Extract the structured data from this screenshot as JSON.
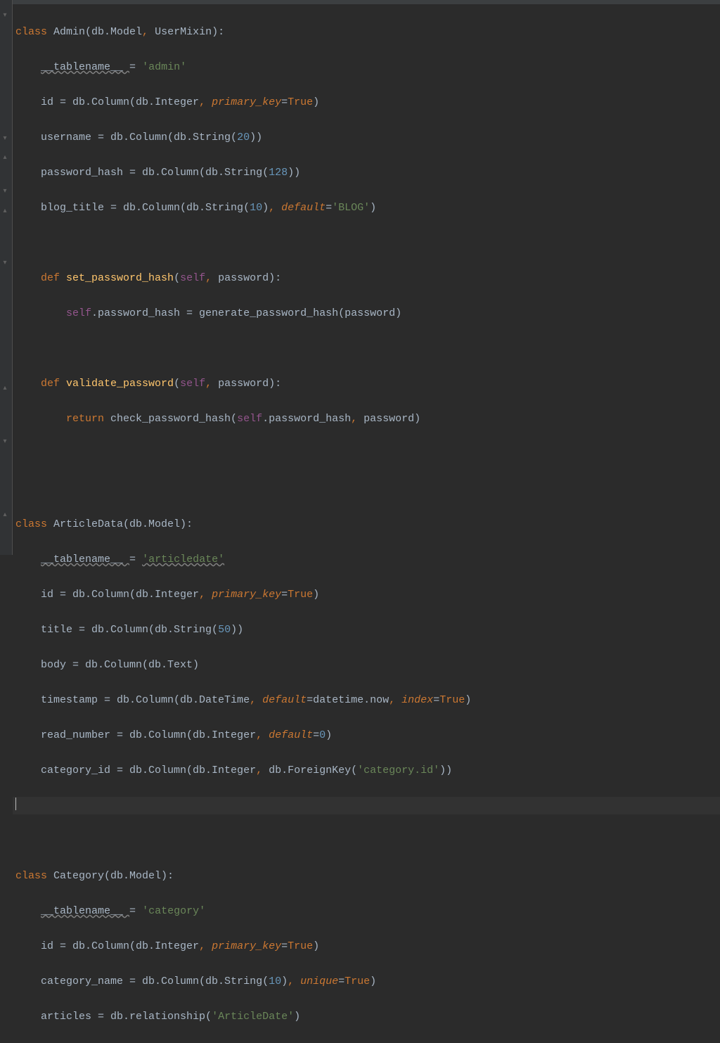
{
  "code": {
    "l1": {
      "kw1": "class ",
      "name": "Admin",
      "rest1": "(db.Model",
      "comma": ", ",
      "rest2": "UserMixin):"
    },
    "l2": {
      "attr": "__tablename__ ",
      "eq": "= ",
      "str": "'admin'"
    },
    "l3": {
      "a": "id = db.Column(db.Integer",
      "c": ", ",
      "p": "primary_key",
      "eq": "=",
      "kw": "True",
      "r": ")"
    },
    "l4": {
      "a": "username = db.Column(db.String(",
      "n": "20",
      "r": "))"
    },
    "l5": {
      "a": "password_hash = db.Column(db.String(",
      "n": "128",
      "r": "))"
    },
    "l6": {
      "a": "blog_title = db.Column(db.String(",
      "n": "10",
      "r1": ")",
      "c": ", ",
      "p": "default",
      "eq": "=",
      "s": "'BLOG'",
      "r2": ")"
    },
    "l8": {
      "kw": "def ",
      "fn": "set_password_hash",
      "op": "(",
      "self": "self",
      "c": ", ",
      "arg": "password):"
    },
    "l9": {
      "self": "self",
      "rest": ".password_hash = generate_password_hash(password)"
    },
    "l11": {
      "kw": "def ",
      "fn": "validate_password",
      "op": "(",
      "self": "self",
      "c": ", ",
      "arg": "password):"
    },
    "l12": {
      "kw": "return ",
      "a": "check_password_hash(",
      "self": "self",
      "rest": ".password_hash",
      "c": ", ",
      "r": "password)"
    },
    "l15": {
      "kw": "class ",
      "name": "ArticleData",
      "rest": "(db.Model):"
    },
    "l16": {
      "attr": "__tablename__ ",
      "eq": "= ",
      "str": "'articledate'"
    },
    "l17": {
      "a": "id = db.Column(db.Integer",
      "c": ", ",
      "p": "primary_key",
      "eq": "=",
      "kw": "True",
      "r": ")"
    },
    "l18": {
      "a": "title = db.Column(db.String(",
      "n": "50",
      "r": "))"
    },
    "l19": {
      "a": "body = db.Column(db.Text)"
    },
    "l20": {
      "a": "timestamp = db.Column(db.DateTime",
      "c1": ", ",
      "p1": "default",
      "eq1": "=",
      "v1": "datetime.now",
      "c2": ", ",
      "p2": "index",
      "eq2": "=",
      "kw": "True",
      "r": ")"
    },
    "l21": {
      "a": "read_number = db.Column(db.Integer",
      "c": ", ",
      "p": "default",
      "eq": "=",
      "n": "0",
      "r": ")"
    },
    "l22": {
      "a": "category_id = db.Column(db.Integer",
      "c": ", ",
      "b": "db.ForeignKey(",
      "s": "'category.id'",
      "r": "))"
    },
    "l25": {
      "kw": "class ",
      "name": "Category",
      "rest": "(db.Model):"
    },
    "l26": {
      "attr": "__tablename__ ",
      "eq": "= ",
      "str": "'category'"
    },
    "l27": {
      "a": "id = db.Column(db.Integer",
      "c": ", ",
      "p": "primary_key",
      "eq": "=",
      "kw": "True",
      "r": ")"
    },
    "l28": {
      "a": "category_name = db.Column(db.String(",
      "n": "10",
      "r1": ")",
      "c": ", ",
      "p": "unique",
      "eq": "=",
      "kw": "True",
      "r2": ")"
    },
    "l29": {
      "a": "articles = db.relationship(",
      "s": "'ArticleDate'",
      "r": ")"
    }
  },
  "indent": {
    "i1": "    ",
    "i2": "        "
  }
}
